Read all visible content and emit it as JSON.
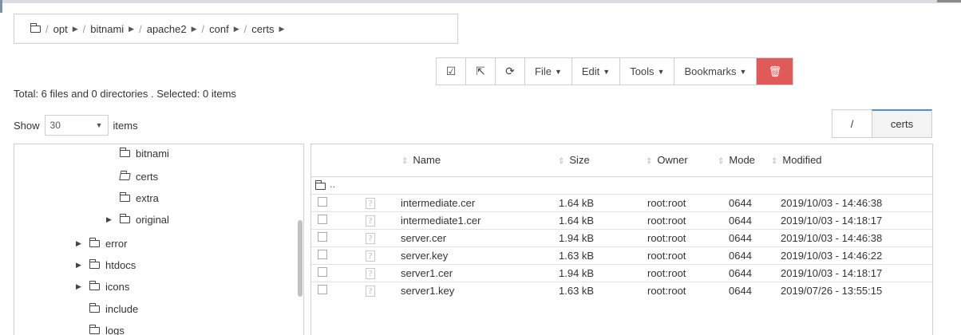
{
  "breadcrumb": {
    "items": [
      {
        "label": "opt"
      },
      {
        "label": "bitnami"
      },
      {
        "label": "apache2"
      },
      {
        "label": "conf"
      },
      {
        "label": "certs"
      }
    ]
  },
  "toolbar": {
    "file": "File",
    "edit": "Edit",
    "tools": "Tools",
    "bookmarks": "Bookmarks",
    "danger_color": "#e15a5a"
  },
  "summary": "Total: 6 files and 0 directories . Selected: 0 items",
  "show": {
    "label_before": "Show",
    "value": "30",
    "label_after": "items"
  },
  "path_tabs": {
    "root": "/",
    "current": "certs"
  },
  "tree": [
    {
      "label": "bitnami"
    },
    {
      "label": "certs"
    },
    {
      "label": "extra"
    },
    {
      "label": "original"
    },
    {
      "label": "error"
    },
    {
      "label": "htdocs"
    },
    {
      "label": "icons"
    },
    {
      "label": "include"
    },
    {
      "label": "logs"
    }
  ],
  "table": {
    "headers": {
      "name": "Name",
      "size": "Size",
      "owner": "Owner",
      "mode": "Mode",
      "modified": "Modified"
    },
    "up_label": "..",
    "rows": [
      {
        "name": "intermediate.cer",
        "size": "1.64 kB",
        "owner": "root:root",
        "mode": "0644",
        "modified": "2019/10/03 - 14:46:38"
      },
      {
        "name": "intermediate1.cer",
        "size": "1.64 kB",
        "owner": "root:root",
        "mode": "0644",
        "modified": "2019/10/03 - 14:18:17"
      },
      {
        "name": "server.cer",
        "size": "1.94 kB",
        "owner": "root:root",
        "mode": "0644",
        "modified": "2019/10/03 - 14:46:38"
      },
      {
        "name": "server.key",
        "size": "1.63 kB",
        "owner": "root:root",
        "mode": "0644",
        "modified": "2019/10/03 - 14:46:22"
      },
      {
        "name": "server1.cer",
        "size": "1.94 kB",
        "owner": "root:root",
        "mode": "0644",
        "modified": "2019/10/03 - 14:18:17"
      },
      {
        "name": "server1.key",
        "size": "1.63 kB",
        "owner": "root:root",
        "mode": "0644",
        "modified": "2019/07/26 - 13:55:15"
      }
    ]
  }
}
